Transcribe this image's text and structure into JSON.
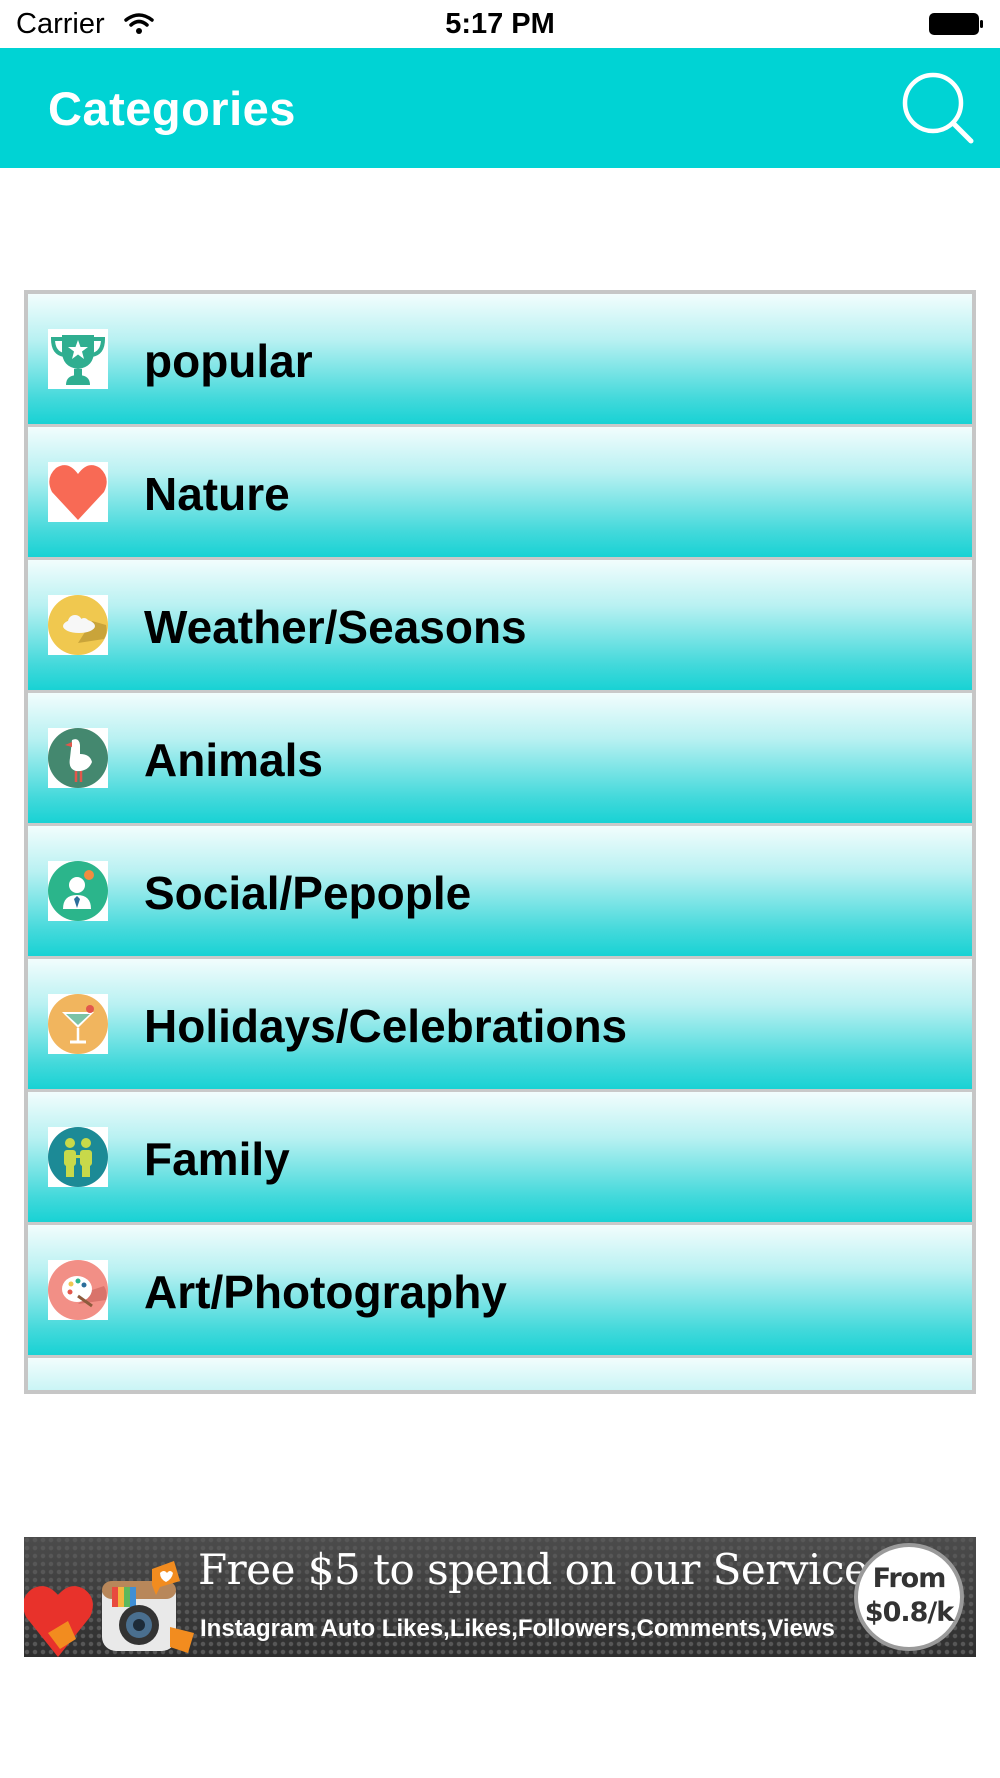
{
  "status_bar": {
    "carrier": "Carrier",
    "time": "5:17 PM"
  },
  "nav_bar": {
    "title": "Categories",
    "background": "#00d3d4",
    "search_icon": "search-icon"
  },
  "categories": [
    {
      "label": "popular",
      "icon": "trophy-icon"
    },
    {
      "label": "Nature",
      "icon": "heart-icon"
    },
    {
      "label": "Weather/Seasons",
      "icon": "cloud-icon"
    },
    {
      "label": "Animals",
      "icon": "bird-icon"
    },
    {
      "label": "Social/Pepople",
      "icon": "person-icon"
    },
    {
      "label": "Holidays/Celebrations",
      "icon": "cocktail-icon"
    },
    {
      "label": "Family",
      "icon": "family-icon"
    },
    {
      "label": "Art/Photography",
      "icon": "palette-icon"
    }
  ],
  "ad_banner": {
    "headline": "Free $5 to spend on our Services",
    "subline": "Instagram Auto Likes,Likes,Followers,Comments,Views",
    "badge_line1": "From",
    "badge_line2": "$0.8/k"
  }
}
